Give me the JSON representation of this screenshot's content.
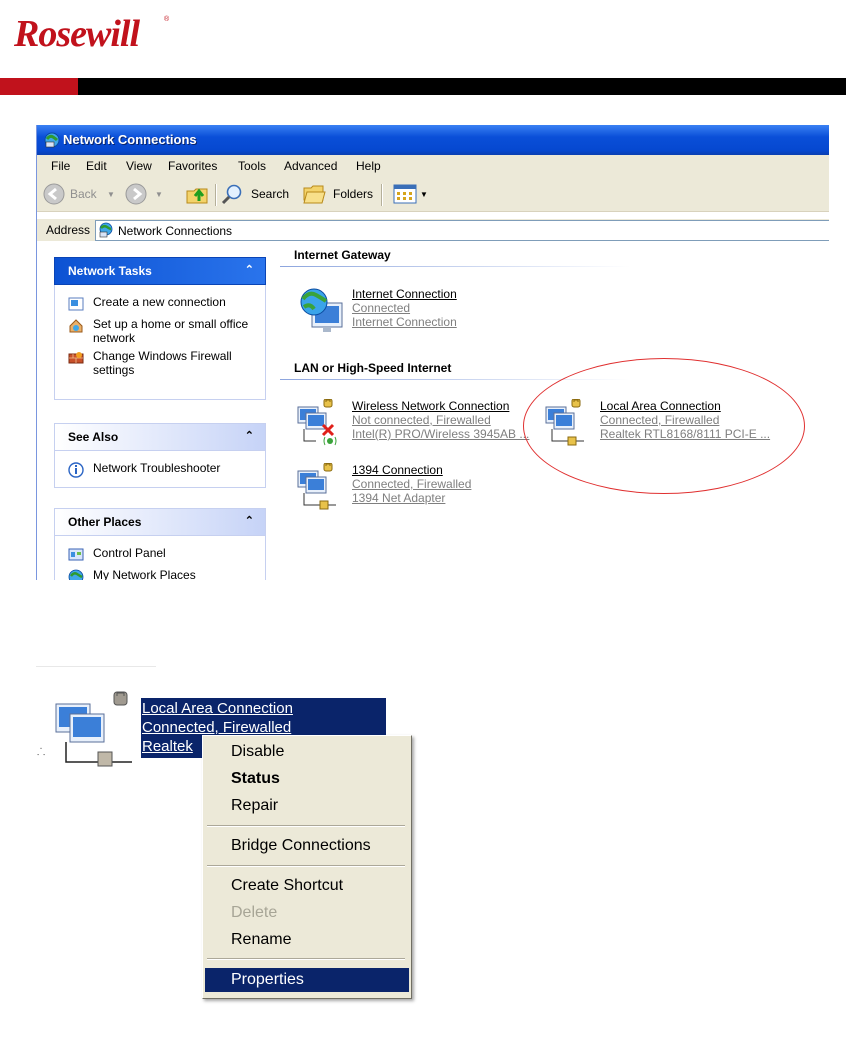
{
  "logo": {
    "text": "Rosewill",
    "reg": "®"
  },
  "window": {
    "title": "Network Connections",
    "menu": [
      "File",
      "Edit",
      "View",
      "Favorites",
      "Tools",
      "Advanced",
      "Help"
    ],
    "toolbar": {
      "back": "Back",
      "search": "Search",
      "folders": "Folders"
    },
    "address": {
      "label": "Address",
      "value": "Network Connections"
    }
  },
  "leftpane": {
    "network_tasks": {
      "title": "Network Tasks",
      "items": [
        "Create a new connection",
        "Set up a home or small office network",
        "Change Windows Firewall settings"
      ]
    },
    "see_also": {
      "title": "See Also",
      "items": [
        "Network Troubleshooter"
      ]
    },
    "other_places": {
      "title": "Other Places",
      "items": [
        "Control Panel",
        "My Network Places"
      ]
    }
  },
  "content": {
    "gateway": {
      "title": "Internet Gateway",
      "item": {
        "name": "Internet Connection",
        "status": "Connected",
        "device": "Internet Connection"
      }
    },
    "lan": {
      "title": "LAN or High-Speed Internet",
      "items": [
        {
          "name": "Wireless Network Connection",
          "status": "Not connected, Firewalled",
          "device": "Intel(R) PRO/Wireless 3945AB ..."
        },
        {
          "name": "Local Area Connection",
          "status": "Connected, Firewalled",
          "device": "Realtek RTL8168/8111 PCI-E ..."
        },
        {
          "name": "1394 Connection",
          "status": "Connected, Firewalled",
          "device": "1394 Net Adapter"
        }
      ]
    }
  },
  "zoom": {
    "name": "Local Area Connection",
    "status": "Connected, Firewalled",
    "device": "Realtek",
    "dot": "⸫"
  },
  "context_menu": {
    "items": [
      "Disable",
      "Status",
      "Repair",
      "Bridge Connections",
      "Create Shortcut",
      "Delete",
      "Rename",
      "Properties"
    ]
  }
}
